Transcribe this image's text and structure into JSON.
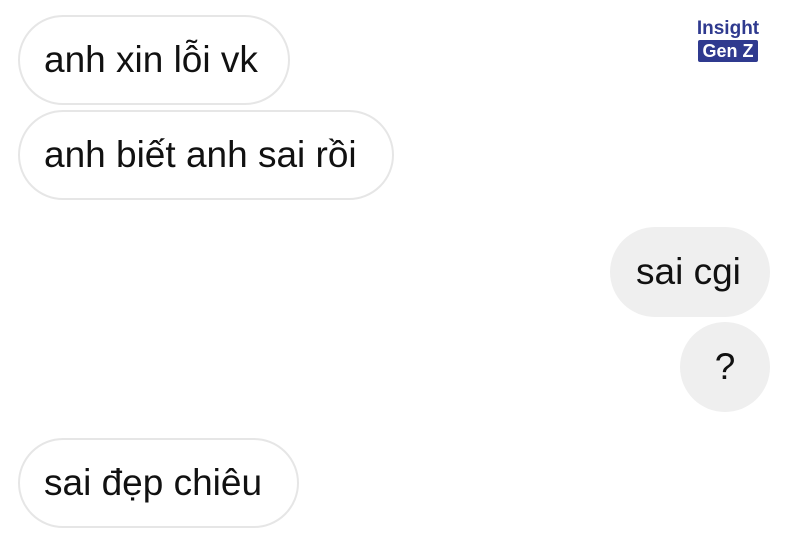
{
  "chat": {
    "messages": [
      {
        "side": "incoming",
        "text": "anh xin lỗi vk"
      },
      {
        "side": "incoming",
        "text": "anh biết anh sai rồi"
      },
      {
        "side": "outgoing",
        "text": "sai cgi"
      },
      {
        "side": "outgoing",
        "text": "?"
      },
      {
        "side": "incoming",
        "text": "sai đẹp chiêu"
      }
    ]
  },
  "watermark": {
    "line1": "Insight",
    "line2": "Gen Z",
    "color": "#2f3a8f"
  },
  "colors": {
    "incoming_bubble_bg": "#ffffff",
    "incoming_bubble_border": "#e6e6e6",
    "outgoing_bubble_bg": "#efefef",
    "text": "#111111"
  }
}
